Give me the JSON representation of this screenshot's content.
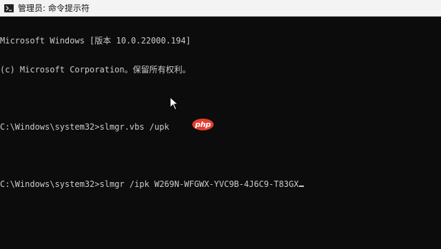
{
  "window": {
    "title": "管理员: 命令提示符",
    "icon": "cmd-icon"
  },
  "console": {
    "lines": [
      "Microsoft Windows [版本 10.0.22000.194]",
      "(c) Microsoft Corporation。保留所有权利。",
      "",
      "C:\\Windows\\system32>slmgr.vbs /upk",
      "",
      "C:\\Windows\\system32>slmgr /ipk W269N-WFGWX-YVC9B-4J6C9-T83GX"
    ],
    "text_color": "#cccccc",
    "background_color": "#0c0c0c"
  },
  "overlay": {
    "pointer_icon": "mouse-pointer-icon",
    "watermark_text": "php",
    "watermark_color": "#e53d2f"
  }
}
